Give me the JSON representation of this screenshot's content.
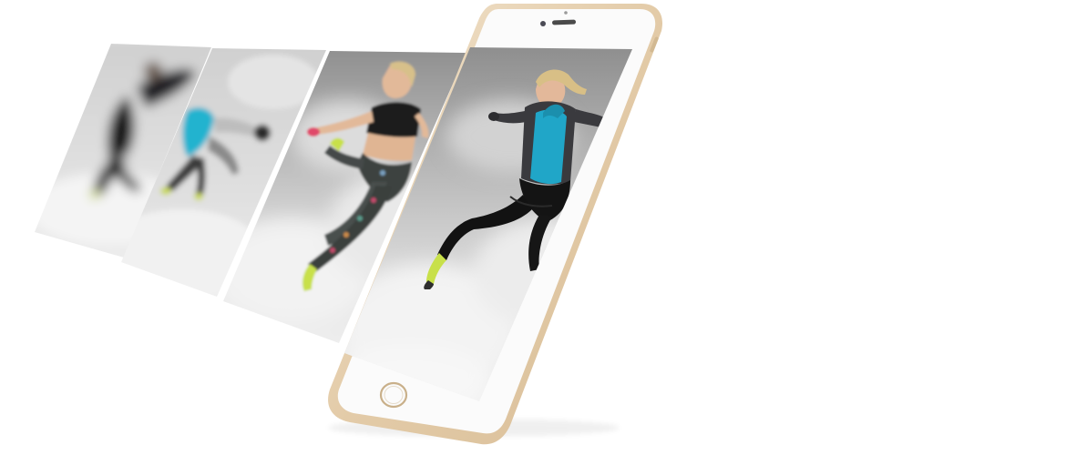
{
  "colors": {
    "background": "#ffffff",
    "phone_gold": "#e7d3b6",
    "phone_face": "#fbfbfb",
    "screen_sky": "#d6d6d6",
    "jacket": "#3a3a3e",
    "top": "#20a6c8",
    "leggings": "#151515",
    "shoes": "#c8e04a"
  },
  "scene": {
    "photos": [
      "photo-frame-1",
      "photo-frame-2",
      "photo-frame-3"
    ],
    "device": "smartphone",
    "home_button_icon": "home-button-icon",
    "camera_icon": "front-camera-icon",
    "speaker_icon": "earpiece-speaker-icon"
  }
}
